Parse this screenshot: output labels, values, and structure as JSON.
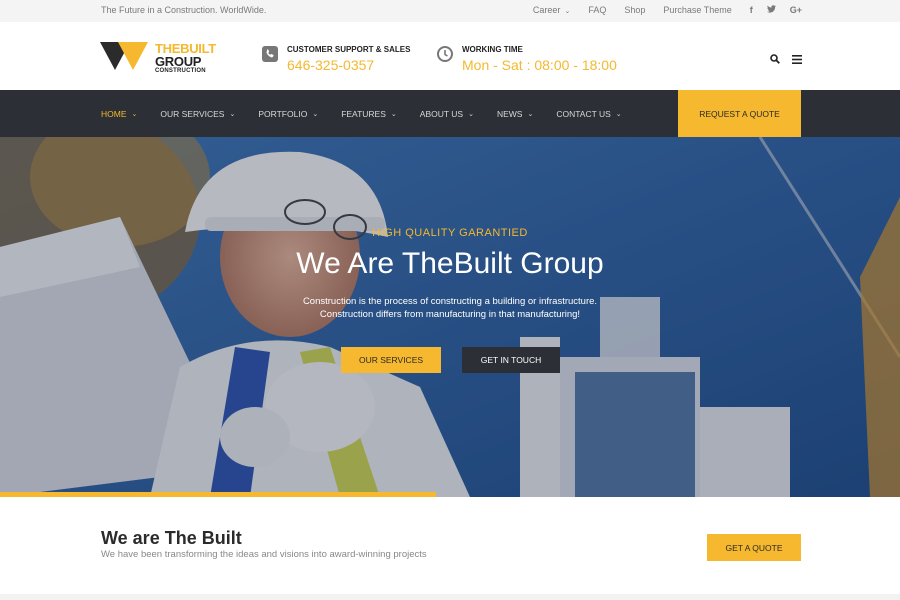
{
  "topbar": {
    "tagline": "The Future in a Construction. WorldWide.",
    "links": [
      "Career",
      "FAQ",
      "Shop",
      "Purchase Theme"
    ],
    "social": [
      "facebook-icon",
      "twitter-icon",
      "google-plus-icon"
    ],
    "social_glyphs": [
      "f",
      "t",
      "G+"
    ]
  },
  "logo": {
    "line1": "THEBUILT",
    "line2": "GROUP",
    "line3": "CONSTRUCTION"
  },
  "header": {
    "support_title": "CUSTOMER SUPPORT & SALES",
    "support_value": "646-325-0357",
    "working_title": "WORKING TIME",
    "working_value": "Mon - Sat : 08:00 - 18:00",
    "icons": [
      "phone-icon",
      "clock-icon",
      "search-icon",
      "menu-icon"
    ]
  },
  "nav": {
    "items": [
      "HOME",
      "OUR SERVICES",
      "PORTFOLIO",
      "FEATURES",
      "ABOUT US",
      "NEWS",
      "CONTACT US"
    ],
    "active_index": 0,
    "quote": "REQUEST A QUOTE"
  },
  "hero": {
    "subtitle": "HIGH QUALITY GARANTIED",
    "title": "We Are TheBuilt Group",
    "desc_line1": "Construction is the process of constructing a building or infrastructure.",
    "desc_line2": "Construction differs from manufacturing in that manufacturing!",
    "btn_primary": "OUR SERVICES",
    "btn_secondary": "GET IN TOUCH"
  },
  "intro": {
    "heading": "We are The Built",
    "text": "We have been transforming the ideas and visions into award-winning projects",
    "button": "GET A QUOTE"
  },
  "colors": {
    "accent": "#f5b82e",
    "dark": "#2c2f35"
  }
}
